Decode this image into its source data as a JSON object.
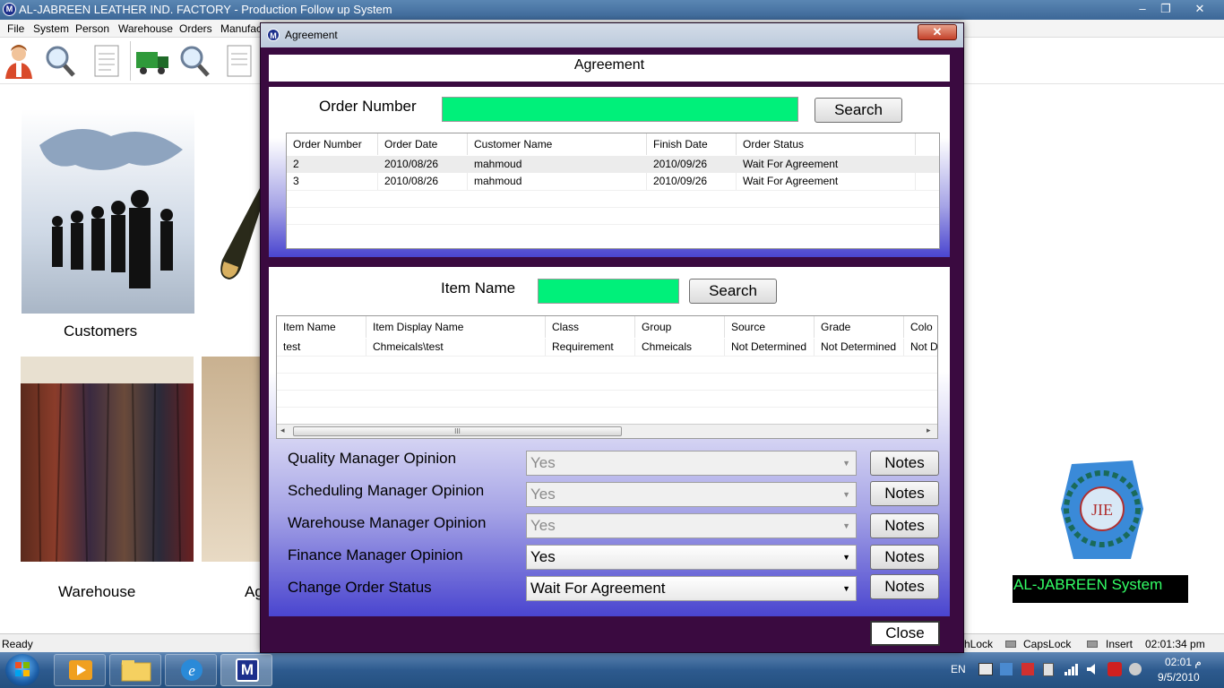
{
  "main_window": {
    "title": "AL-JABREEN LEATHER IND. FACTORY - Production Follow up System",
    "app_icon": "M",
    "controls": {
      "minimize": "–",
      "maximize": "❐",
      "close": "✕"
    }
  },
  "menu": [
    "File",
    "System",
    "Person",
    "Warehouse",
    "Orders",
    "Manufac"
  ],
  "tiles": {
    "customers": "Customers",
    "warehouse": "Warehouse",
    "partial": "Ag"
  },
  "brand": {
    "system_label": "AL-JABREEN System",
    "logo_text": "JIE"
  },
  "statusbar": {
    "ready": "Ready",
    "numlock": "hLock",
    "capslock": "CapsLock",
    "insert": "Insert",
    "time": "02:01:34 pm"
  },
  "taskbar": {
    "lang": "EN",
    "clock_time": "02:01 م",
    "clock_date": "9/5/2010",
    "app_icon": "M"
  },
  "dialog": {
    "title": "Agreement",
    "close_glyph": "✕",
    "header": "Agreement",
    "order_search": {
      "label": "Order Number",
      "value": "",
      "button": "Search"
    },
    "orders_grid": {
      "columns": [
        "Order Number",
        "Order Date",
        "Customer Name",
        "Finish Date",
        "Order Status"
      ],
      "rows": [
        [
          "2",
          "2010/08/26",
          "mahmoud",
          "2010/09/26",
          "Wait For Agreement"
        ],
        [
          "3",
          "2010/08/26",
          "mahmoud",
          "2010/09/26",
          "Wait For Agreement"
        ]
      ]
    },
    "item_search": {
      "label": "Item Name",
      "value": "",
      "button": "Search"
    },
    "items_grid": {
      "columns": [
        "Item Name",
        "Item Display Name",
        "Class",
        "Group",
        "Source",
        "Grade",
        "Colo"
      ],
      "rows": [
        [
          "test",
          "Chmeicals\\test",
          "Requirement",
          "Chmeicals",
          "Not Determined",
          "Not Determined",
          "Not D"
        ]
      ],
      "scroll_grip": "III"
    },
    "opinions": [
      {
        "label": "Quality Manager Opinion",
        "value": "Yes",
        "enabled": false,
        "notes": "Notes"
      },
      {
        "label": "Scheduling Manager Opinion",
        "value": "Yes",
        "enabled": false,
        "notes": "Notes"
      },
      {
        "label": "Warehouse Manager Opinion",
        "value": "Yes",
        "enabled": false,
        "notes": "Notes"
      },
      {
        "label": "Finance Manager Opinion",
        "value": "Yes",
        "enabled": true,
        "notes": "Notes"
      },
      {
        "label": "Change Order Status",
        "value": "Wait For Agreement",
        "enabled": true,
        "notes": "Notes"
      }
    ],
    "close_button": "Close"
  },
  "colors": {
    "dialog_bg": "#3a0a40",
    "search_field": "#00f07a",
    "panel_gradient_end": "#4a45cf",
    "brand_bg": "#000000",
    "brand_text": "#33ff66"
  }
}
